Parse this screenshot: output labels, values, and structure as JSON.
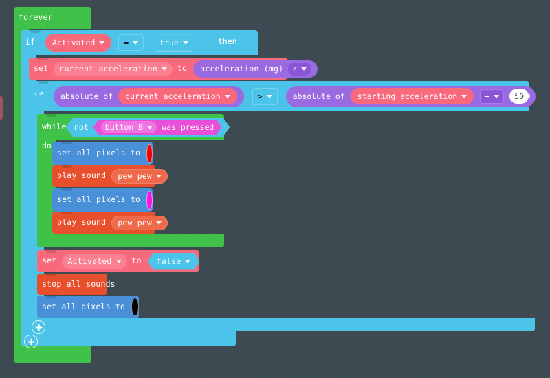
{
  "editor": {
    "name": "makecode-blocks-editor",
    "background_color": "#3e4a51"
  },
  "palette": {
    "loops_green": "#40c24a",
    "logic_blue": "#4cc3e8",
    "variables_pink": "#f8697c",
    "input_purple": "#9a6ae0",
    "music_orange": "#e8502d",
    "light_blue": "#4a90d9",
    "input_magenta": "#e84fd6"
  },
  "blocks": {
    "forever": {
      "label": "forever"
    },
    "if_outer": {
      "if_label": "if",
      "then_label": "then",
      "condition": {
        "left_variable": "Activated",
        "operator": "=",
        "right_value": "true"
      }
    },
    "set_current_acceleration": {
      "set_label": "set",
      "variable": "current acceleration",
      "to_label": "to",
      "value_block": "acceleration (mg)",
      "value_axis": "z"
    },
    "if_inner": {
      "if_label": "if",
      "then_label": "then",
      "left": {
        "function": "absolute of",
        "argument": "current acceleration"
      },
      "operator": ">",
      "right": {
        "function": "absolute of",
        "argument": "starting acceleration",
        "math_operator": "+",
        "number": "50"
      }
    },
    "while_loop": {
      "while_label": "while",
      "do_label": "do",
      "not_label": "not",
      "button": "button B",
      "event": "was pressed"
    },
    "do_body": [
      {
        "name": "set-all-pixels-red",
        "label": "set all pixels to",
        "kind": "pixels",
        "color": "#ee0000"
      },
      {
        "name": "play-sound-pew-pew-1",
        "label": "play sound",
        "kind": "sound",
        "sound": "pew pew"
      },
      {
        "name": "set-all-pixels-magenta",
        "label": "set all pixels to",
        "kind": "pixels",
        "color": "#f514e0"
      },
      {
        "name": "play-sound-pew-pew-2",
        "label": "play sound",
        "kind": "sound",
        "sound": "pew pew"
      }
    ],
    "set_activated_false": {
      "set_label": "set",
      "variable": "Activated",
      "to_label": "to",
      "value": "false"
    },
    "stop_all_sounds": {
      "label": "stop all sounds"
    },
    "set_all_pixels_black": {
      "label": "set all pixels to",
      "color": "#000000"
    },
    "add_branch_buttons": [
      {
        "name": "add-else-inner",
        "icon": "plus-circle-icon"
      },
      {
        "name": "add-else-outer",
        "icon": "plus-circle-icon"
      }
    ]
  }
}
